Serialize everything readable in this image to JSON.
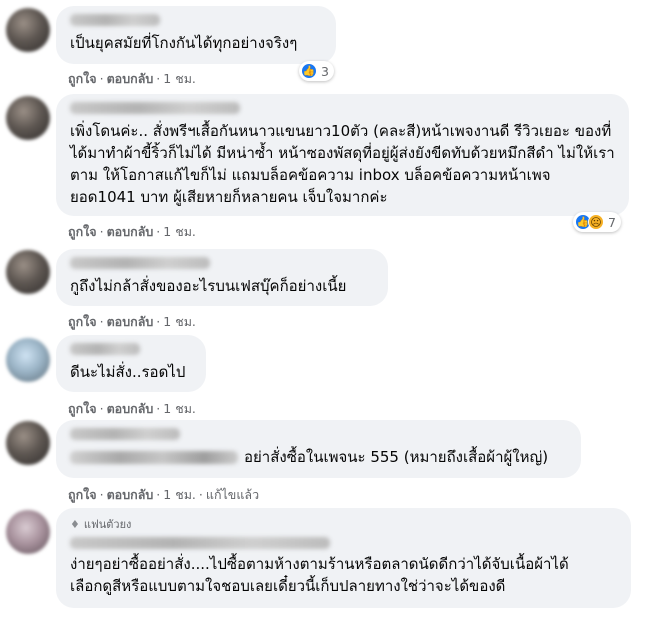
{
  "comments": [
    {
      "text": "เป็นยุคสมัยที่โกงกันได้ทุกอย่างจริงๆ",
      "like": "ถูกใจ",
      "reply": "ตอบกลับ",
      "time": "1 ชม.",
      "reactions": {
        "icons": [
          "like-icon"
        ],
        "count": "3"
      }
    },
    {
      "text": "เพิ่งโดนค่ะ.. สั่งพรีฯเสื้อกันหนาวแขนยาว10ตัว (คละสี)หน้าเพจงานดี รีวิวเยอะ ของที่ได้มาทำผ้าขี้ริ้วก็ไม่ได้ มีหน่าซ้ำ หน้าซองพัสดุที่อยู่ผู้ส่งยังขีดทับด้วยหมึกสีดำ ไม่ให้เราตาม ให้โอกาสแก้ไขก็ไม่ แถมบล็อคข้อความ inbox บล็อคข้อความหน้าเพจ ยอด1041 บาท ผู้เสียหายก็หลายคน เจ็บใจมากค่ะ",
      "like": "ถูกใจ",
      "reply": "ตอบกลับ",
      "time": "1 ชม.",
      "reactions": {
        "icons": [
          "like-icon",
          "sad-icon"
        ],
        "count": "7"
      }
    },
    {
      "text": "กูถึงไม่กล้าสั่งของอะไรบนเฟสบุ๊คก็อย่างเนี้ย",
      "like": "ถูกใจ",
      "reply": "ตอบกลับ",
      "time": "1 ชม."
    },
    {
      "text": "ดีนะไม่สั่ง..รอดไป",
      "like": "ถูกใจ",
      "reply": "ตอบกลับ",
      "time": "1 ชม."
    },
    {
      "text": "อย่าสั่งซื้อในเพจนะ 555 (หมายถึงเสื้อผ้าผู้ใหญ่)",
      "like": "ถูกใจ",
      "reply": "ตอบกลับ",
      "time": "1 ชม.",
      "edited": "แก้ไขแล้ว"
    },
    {
      "badge": "แฟนตัวยง",
      "text_line1": "ง่ายๆอย่าซื้ออย่าสั่ง....ไปซื้อตามห้างตามร้านหรือตลาดนัดดีกว่าได้จับเนื้อผ้าได้",
      "text_line2": "เลือกดูสีหรือแบบตามใจชอบเลยเดี๋ยวนี้เก็บปลายทางใช่ว่าจะได้ของดี"
    }
  ]
}
